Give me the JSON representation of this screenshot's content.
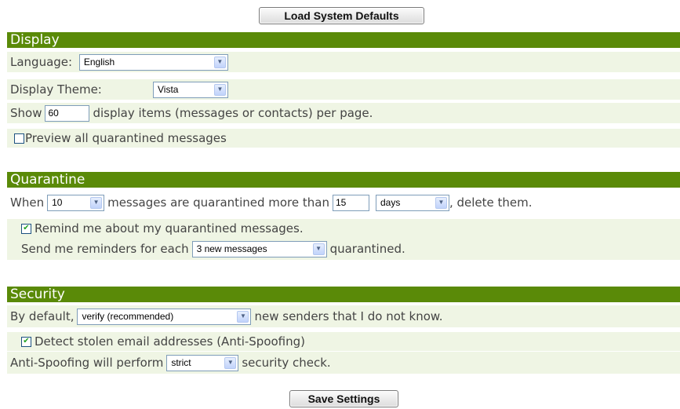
{
  "top_button": "Load System Defaults",
  "display": {
    "header": "Display",
    "language_label": "Language: ",
    "language_value": "English",
    "theme_label": "Display Theme:",
    "theme_value": "Vista",
    "show_label": "Show",
    "show_value": "60",
    "show_suffix": "display items (messages or contacts) per page.",
    "preview_label": "Preview all quarantined messages",
    "preview_checked": false
  },
  "quarantine": {
    "header": "Quarantine",
    "when_label": "When",
    "count_value": "10",
    "middle_text": "messages are quarantined more than",
    "age_value": "15",
    "unit_value": "days",
    "end_text": ", delete them.",
    "remind_label": "Remind me about my quarantined messages.",
    "remind_checked": true,
    "reminder_label": "Send me reminders for each",
    "reminder_value": "3 new messages",
    "reminder_suffix": "quarantined."
  },
  "security": {
    "header": "Security",
    "default_label": "By default,",
    "default_value": "verify (recommended)",
    "default_suffix": "new senders that I do not know.",
    "detect_label": "Detect stolen email addresses (Anti-Spoofing)",
    "detect_checked": true,
    "spoof_label": "Anti-Spoofing will perform",
    "spoof_value": "strict",
    "spoof_suffix": "security check."
  },
  "save_button": "Save Settings",
  "colors": {
    "header": "#5a8a08",
    "row": "#eff5e4"
  },
  "icons": {
    "dropdown": "chevron-down-icon",
    "check": "checkmark-icon"
  }
}
